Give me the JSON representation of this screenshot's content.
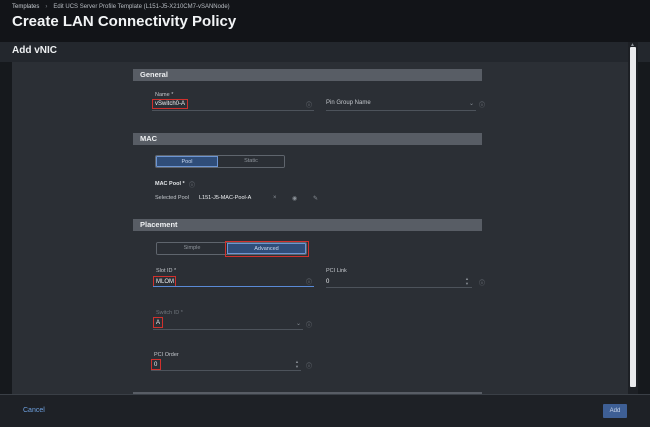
{
  "breadcrumb": {
    "root": "Templates",
    "separator": "›",
    "current": "Edit UCS Server Profile Template (L151-J5-X210CM7-vSANNode)"
  },
  "page": {
    "title": "Create LAN Connectivity Policy"
  },
  "modal": {
    "title": "Add vNIC"
  },
  "general": {
    "heading": "General",
    "name_label": "Name *",
    "name_value": "vSwitch0-A",
    "pin_group_label": "Pin Group Name"
  },
  "mac": {
    "heading": "MAC",
    "pool_option": "Pool",
    "static_option": "Static",
    "mac_pool_label": "MAC Pool *",
    "selected_pool_label": "Selected Pool",
    "selected_pool_value": "L151-J5-MAC-Pool-A"
  },
  "placement": {
    "heading": "Placement",
    "simple_option": "Simple",
    "advanced_option": "Advanced",
    "slot_id_label": "Slot ID *",
    "slot_id_value": "MLOM",
    "pci_link_label": "PCI Link",
    "pci_link_value": "0",
    "switch_id_label": "Switch ID *",
    "switch_id_value": "A",
    "pci_order_label": "PCI Order",
    "pci_order_value": "0"
  },
  "footer": {
    "cancel_label": "Cancel",
    "add_label": "Add"
  }
}
